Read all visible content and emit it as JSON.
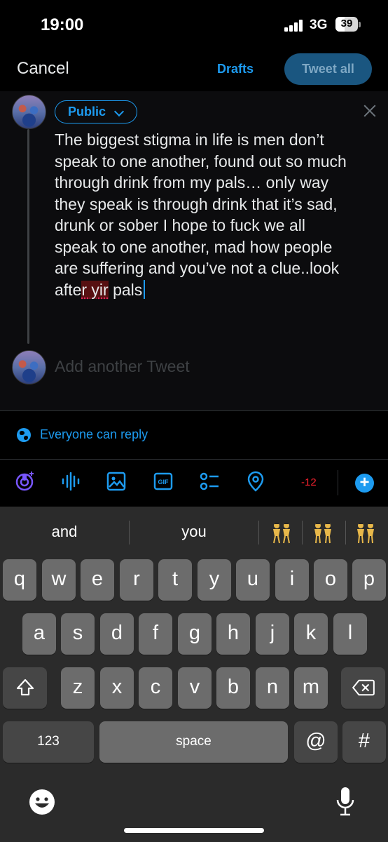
{
  "status_bar": {
    "time": "19:00",
    "network": "3G",
    "battery": "39"
  },
  "header": {
    "cancel_label": "Cancel",
    "drafts_label": "Drafts",
    "tweet_all_label": "Tweet all"
  },
  "compose": {
    "audience_label": "Public",
    "text_before": "The biggest stigma in life is men don’t speak to one another, found out so much through drink from my pals… only way they speak is through drink that it’s sad, drunk or sober I hope to fuck we all speak to one another, mad how people are suffering and you’ve not a clue..look afte",
    "text_misspelled": "r yir",
    "text_after": " pals",
    "add_another_placeholder": "Add another Tweet"
  },
  "reply_setting": {
    "label": "Everyone can reply"
  },
  "toolbar": {
    "icons": [
      "spaces-icon",
      "audio-icon",
      "image-icon",
      "gif-icon",
      "poll-icon",
      "location-icon"
    ],
    "gif_label": "GIF",
    "char_counter": "-12",
    "accent_color": "#1d9bf0",
    "counter_color": "#f4212e"
  },
  "keyboard": {
    "suggestions": [
      "and",
      "you"
    ],
    "emoji_suggestions": [
      "dancers-emoji",
      "dancers-emoji",
      "dancers-emoji"
    ],
    "row1": [
      "q",
      "w",
      "e",
      "r",
      "t",
      "y",
      "u",
      "i",
      "o",
      "p"
    ],
    "row2": [
      "a",
      "s",
      "d",
      "f",
      "g",
      "h",
      "j",
      "k",
      "l"
    ],
    "row3": [
      "z",
      "x",
      "c",
      "v",
      "b",
      "n",
      "m"
    ],
    "numbers_label": "123",
    "space_label": "space",
    "at_label": "@",
    "hash_label": "#"
  }
}
